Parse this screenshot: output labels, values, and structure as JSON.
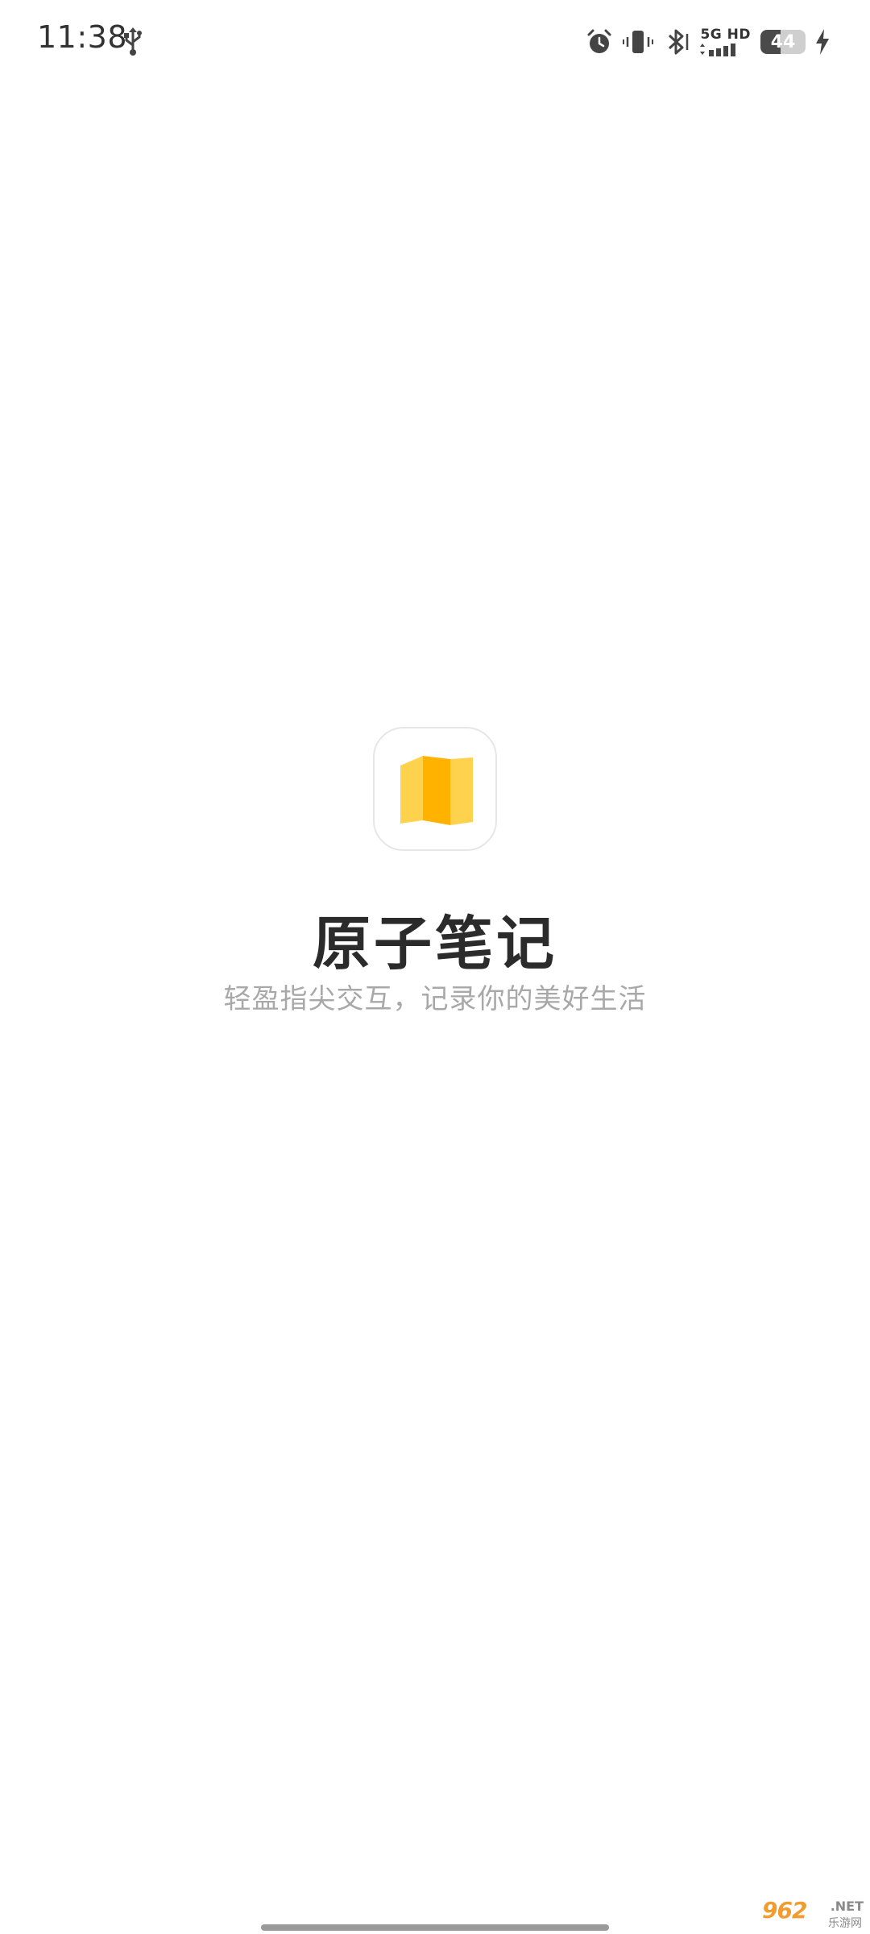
{
  "status_bar": {
    "time": "11:38",
    "network": {
      "type": "5G",
      "quality": "HD"
    },
    "battery": {
      "level": 44,
      "label": "44",
      "charging": true
    },
    "icons": [
      "usb-icon",
      "alarm-icon",
      "vibrate-icon",
      "bluetooth-icon",
      "signal-icon",
      "battery-icon",
      "charging-bolt-icon"
    ]
  },
  "splash": {
    "app_name": "原子笔记",
    "tagline": "轻盈指尖交互，记录你的美好生活",
    "logo_icon": "n-note-logo-icon",
    "colors": {
      "logo_yellow_light": "#FFD24D",
      "logo_yellow_dark": "#FFB300",
      "title": "#2B2B2B",
      "tagline": "#A8A8A8"
    }
  },
  "watermark": {
    "main": "962",
    "suffix": ".NET",
    "sub": "乐游网"
  }
}
